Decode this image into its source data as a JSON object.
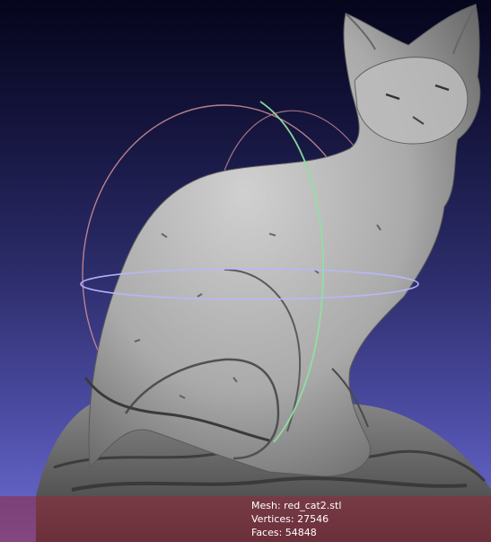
{
  "viewer": {
    "mesh_label": "Mesh: red_cat2.stl",
    "vertices_label": "Vertices: 27546",
    "faces_label": "Faces: 54848"
  },
  "icons": {
    "trackball": "trackball-gizmo-icon"
  },
  "colors": {
    "background_top": "#05051c",
    "background_bottom": "#6c6cd4",
    "mesh_fill": "#b5b5b5",
    "trackball_red": "#c98b95",
    "trackball_green": "#90e0a0",
    "trackball_blue": "#b7b7ff",
    "info_bar": "#96283c"
  }
}
